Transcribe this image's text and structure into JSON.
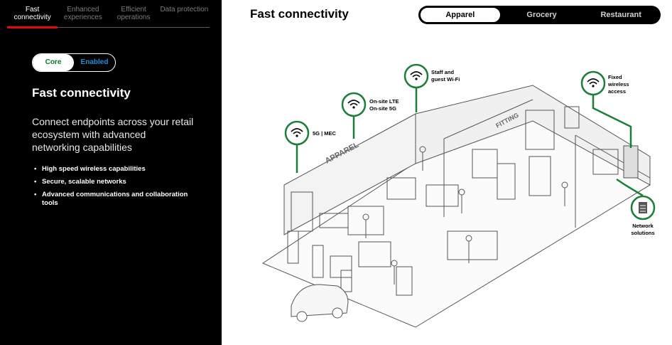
{
  "nav": {
    "tabs": [
      {
        "label": "Fast connectivity"
      },
      {
        "label": "Enhanced experiences"
      },
      {
        "label": "Efficient operations"
      },
      {
        "label": "Data protection"
      }
    ]
  },
  "toggle": {
    "left": "Core",
    "right": "Enabled"
  },
  "left_panel": {
    "title": "Fast connectivity",
    "description": "Connect endpoints across your retail ecosystem with advanced networking capabilities",
    "bullets": [
      "High speed wireless capabilities",
      "Secure, scalable networks",
      "Advanced communications and collaboration tools"
    ]
  },
  "main": {
    "title": "Fast connectivity",
    "segments": [
      "Apparel",
      "Grocery",
      "Restaurant"
    ],
    "selected_segment": "Apparel"
  },
  "diagram": {
    "pins": [
      {
        "line1": "5G | MEC",
        "line2": ""
      },
      {
        "line1": "On-site LTE",
        "line2": "On-site 5G"
      },
      {
        "line1": "Staff and",
        "line2": "guest Wi-Fi"
      },
      {
        "line1": "Fixed",
        "line2": "wireless",
        "line3": "access"
      },
      {
        "line1": "Network",
        "line2": "solutions"
      }
    ],
    "signs": [
      "APPAREL",
      "FITTING"
    ]
  },
  "colors": {
    "accent_red": "#e30613",
    "pin_green": "#1a7f37",
    "toggle_blue": "#1f8fd8"
  }
}
